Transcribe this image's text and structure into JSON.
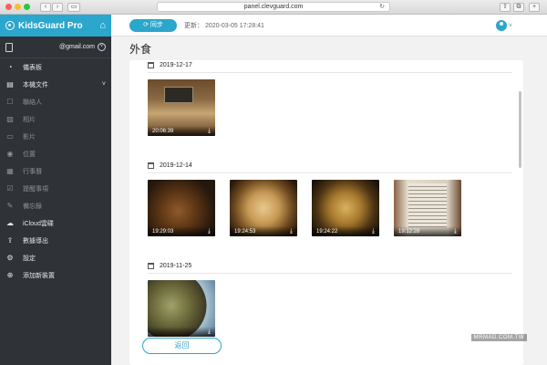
{
  "browser": {
    "url": "panel.clevguard.com"
  },
  "brand": {
    "name": "KidsGuard Pro"
  },
  "account": {
    "email": "@gmail.com"
  },
  "nav": [
    {
      "label": "儀表板",
      "icon": "dashboard-icon",
      "sub": false
    },
    {
      "label": "本機文件",
      "icon": "folder-icon",
      "sub": false,
      "expand": true
    },
    {
      "label": "聯絡人",
      "icon": "contacts-icon",
      "sub": true
    },
    {
      "label": "相片",
      "icon": "photo-icon",
      "sub": true
    },
    {
      "label": "影片",
      "icon": "video-icon",
      "sub": true
    },
    {
      "label": "位置",
      "icon": "location-icon",
      "sub": true
    },
    {
      "label": "行事曆",
      "icon": "calendar-icon",
      "sub": true
    },
    {
      "label": "提醒事項",
      "icon": "reminder-icon",
      "sub": true
    },
    {
      "label": "備忘錄",
      "icon": "notes-icon",
      "sub": true
    },
    {
      "label": "iCloud雲碟",
      "icon": "cloud-icon",
      "sub": false
    },
    {
      "label": "數據導出",
      "icon": "export-icon",
      "sub": false
    },
    {
      "label": "設定",
      "icon": "gear-icon",
      "sub": false
    },
    {
      "label": "添加新裝置",
      "icon": "plus-circle-icon",
      "sub": false
    }
  ],
  "topbar": {
    "sync_label": "同步",
    "updated_label": "更新：",
    "updated_time": "2020-03-05 17:28:41"
  },
  "page": {
    "title": "外食",
    "back_label": "返回"
  },
  "groups": [
    {
      "date": "2019-12-17",
      "photos": [
        {
          "time": "20:06:39"
        }
      ]
    },
    {
      "date": "2019-12-14",
      "photos": [
        {
          "time": "19:29:03"
        },
        {
          "time": "19:24:53"
        },
        {
          "time": "19:24:22"
        },
        {
          "time": "19:12:28"
        }
      ]
    },
    {
      "date": "2019-11-25",
      "photos": [
        {
          "time": ""
        }
      ]
    }
  ],
  "watermark": "MRMAD.COM.TW",
  "colors": {
    "accent": "#2ba6cc",
    "sidebar": "#2f3338"
  }
}
